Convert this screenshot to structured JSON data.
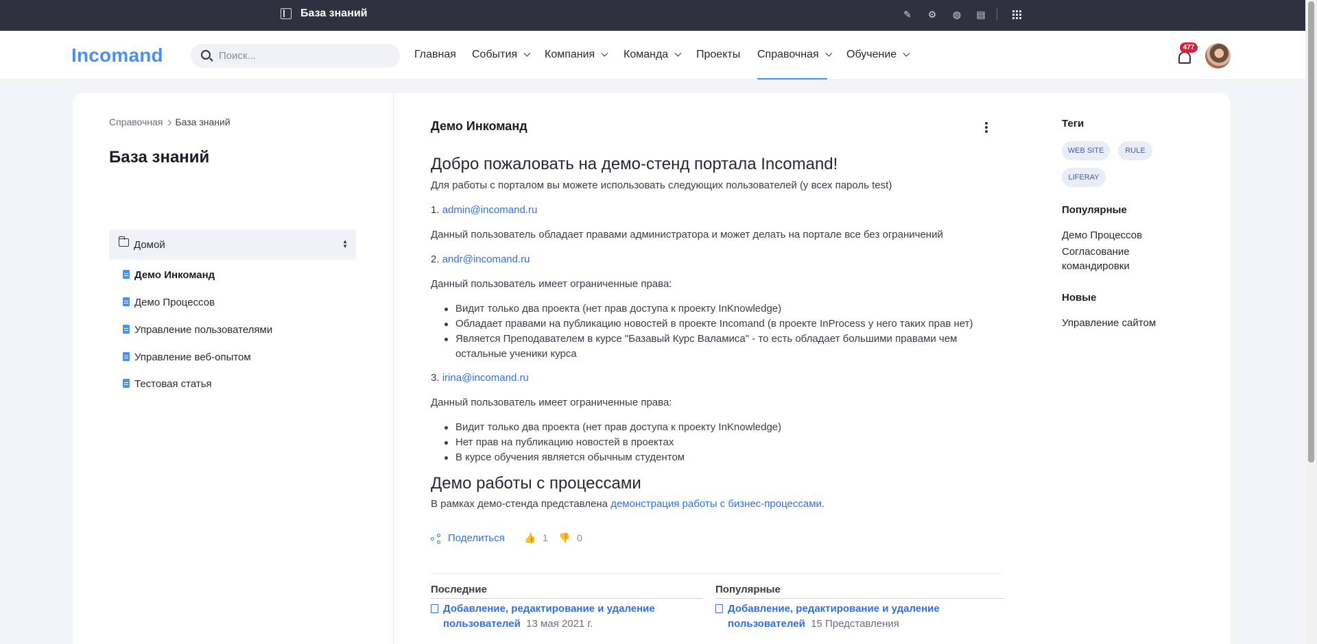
{
  "adminbar": {
    "title": "База знаний",
    "icons": [
      "pencil-icon",
      "gear-icon",
      "globe-icon",
      "preview-icon",
      "apps-grid-icon"
    ]
  },
  "header": {
    "logo": "Incomand",
    "search_placeholder": "Поиск...",
    "nav": [
      {
        "label": "Главная"
      },
      {
        "label": "События"
      },
      {
        "label": "Компания"
      },
      {
        "label": "Команда"
      },
      {
        "label": "Проекты"
      },
      {
        "label": "Справочная"
      },
      {
        "label": "Обучение"
      }
    ],
    "notifications": "477"
  },
  "left": {
    "breadcrumb": [
      "Справочная",
      "База знаний"
    ],
    "title": "База знаний",
    "folder": "Домой",
    "items": [
      "Демо Инкоманд",
      "Демо Процессов",
      "Управление пользователями",
      "Управление веб-опытом",
      "Тестовая статья"
    ]
  },
  "article": {
    "title": "Демо Инкоманд",
    "h1": "Добро пожаловать на демо-стенд портала Incomand!",
    "intro": "Для работы с порталом вы можете использовать следующих пользователей (у всех пароль test)",
    "user1_num": "1.",
    "user1_email": "admin@incomand.ru",
    "user1_desc": "Данный пользователь обладает правами администратора и может делать на портале все без ограничений",
    "user2_num": "2.",
    "user2_email": "andr@incomand.ru",
    "user2_desc": "Данный пользователь имеет ограниченные права:",
    "user2_rights": [
      "Видит только два проекта (нет прав доступа к проекту InKnowledge)",
      "Обладает правами на публикацию новостей в проекте Incomand (в проекте InProcess у него таких прав нет)",
      "Является Преподавателем в курсе \"Базавый Курс Валамиса\" - то есть обладает большими правами чем остальные ученики курса"
    ],
    "user3_num": "3.",
    "user3_email": "irina@incomand.ru",
    "user3_desc": "Данный пользователь имеет ограниченные права:",
    "user3_rights": [
      "Видит только два проекта (нет прав доступа к проекту InKnowledge)",
      "Нет прав на публикацию новостей в проектах",
      "В курсе обучения является обычным студентом"
    ],
    "h2": "Демо работы с процессами",
    "process_text": "В рамках демо-стенда представлена",
    "process_link": "демонстрация работы с бизнес-процессами.",
    "share": "Поделиться",
    "likes": "1",
    "dislikes": "0",
    "recent_header": "Последние",
    "recent_link": "Добавление, редактирование и удаление пользователей",
    "recent_meta": "13 мая 2021 г.",
    "popular_header": "Популярные",
    "popular_link": "Добавление, редактирование и удаление пользователей",
    "popular_meta": "15 Представления"
  },
  "sidebar": {
    "tags_header": "Теги",
    "tags": [
      "WEB SITE",
      "RULE",
      "LIFERAY"
    ],
    "popular_header": "Популярные",
    "popular": [
      "Демо Процессов",
      "Согласование командировки"
    ],
    "new_header": "Новые",
    "new": [
      "Управление сайтом"
    ]
  },
  "colors": {
    "adminbar_bg": "#30313f",
    "accent": "#4a90ee",
    "link": "#2f6fe0",
    "badge": "#d0233a"
  }
}
